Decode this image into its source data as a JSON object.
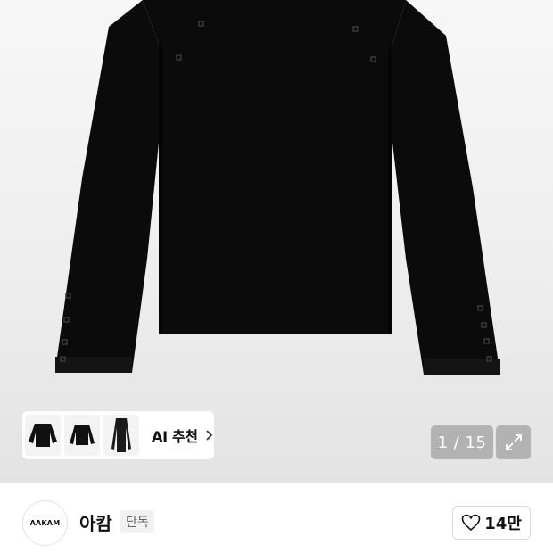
{
  "gallery": {
    "ai_recommend_label": "AI 추천",
    "page_counter": "1 / 15",
    "thumbnail_count": 3
  },
  "brand": {
    "logo_text": "AAKAM",
    "name": "아캄",
    "badge": "단독"
  },
  "like": {
    "count": "14만"
  },
  "icons": {
    "expand": "expand-icon",
    "heart": "heart-icon",
    "chevron": "chevron-right-icon"
  },
  "colors": {
    "garment": "#0b0b0b",
    "overlay": "#000000",
    "text": "#111111"
  }
}
